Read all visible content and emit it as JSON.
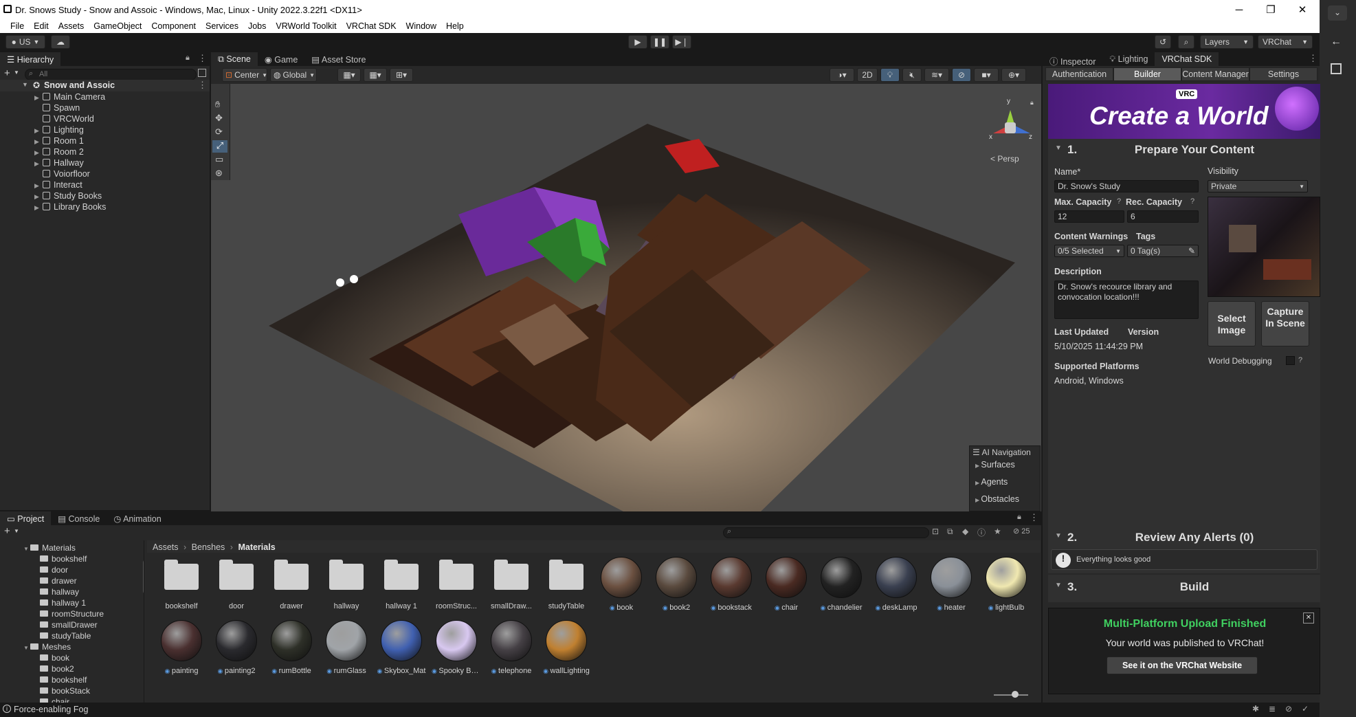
{
  "window": {
    "title": "Dr. Snows Study - Snow and Assoic - Windows, Mac, Linux - Unity 2022.3.22f1 <DX11>",
    "minimize": "─",
    "maximize": "❐",
    "close": "✕"
  },
  "menu": [
    "File",
    "Edit",
    "Assets",
    "GameObject",
    "Component",
    "Services",
    "Jobs",
    "VRWorld Toolkit",
    "VRChat SDK",
    "Window",
    "Help"
  ],
  "toolbar": {
    "account": "US",
    "layers": "Layers",
    "layout": "VRChat"
  },
  "hierarchy": {
    "tab": "Hierarchy",
    "search_placeholder": "All",
    "root": "Snow and Assoic",
    "items": [
      {
        "label": "Main Camera",
        "arrow": true
      },
      {
        "label": "Spawn",
        "arrow": false
      },
      {
        "label": "VRCWorld",
        "arrow": false
      },
      {
        "label": "Lighting",
        "arrow": true
      },
      {
        "label": "Room 1",
        "arrow": true
      },
      {
        "label": "Room 2",
        "arrow": true
      },
      {
        "label": "Hallway",
        "arrow": true
      },
      {
        "label": "Voiorfloor",
        "arrow": false
      },
      {
        "label": "Interact",
        "arrow": true
      },
      {
        "label": "Study Books",
        "arrow": true
      },
      {
        "label": "Library Books",
        "arrow": true
      }
    ]
  },
  "scene_tabs": [
    "Scene",
    "Game",
    "Asset Store"
  ],
  "scene_toolbar": {
    "pivot": "Center",
    "space": "Global",
    "mode2d": "2D"
  },
  "gizmo": {
    "persp": "< Persp",
    "y": "y",
    "x": "x",
    "z": "z"
  },
  "ai_nav": {
    "title": "AI Navigation",
    "items": [
      "Surfaces",
      "Agents",
      "Obstacles"
    ]
  },
  "inspector": {
    "tabs": [
      "Inspector",
      "Lighting",
      "VRChat SDK"
    ],
    "sdk_tabs": [
      "Authentication",
      "Builder",
      "Content Manager",
      "Settings"
    ],
    "banner": "Create a World",
    "banner_badge": "VRC",
    "sec1": {
      "num": "1.",
      "title": "Prepare Your Content"
    },
    "name_label": "Name*",
    "name_value": "Dr. Snow's Study",
    "visibility_label": "Visibility",
    "visibility_value": "Private",
    "maxcap_label": "Max. Capacity",
    "maxcap_value": "12",
    "reccap_label": "Rec. Capacity",
    "reccap_value": "6",
    "cw_label": "Content Warnings",
    "tags_label": "Tags",
    "cw_value": "0/5 Selected",
    "tags_value": "0 Tag(s)",
    "desc_label": "Description",
    "desc_value": "Dr. Snow's recource library and convocation location!!!",
    "updated_label": "Last Updated",
    "updated_value": "5/10/2025 11:44:29 PM",
    "version_label": "Version",
    "platforms_label": "Supported Platforms",
    "platforms_value": "Android, Windows",
    "select_image": "Select Image",
    "capture": "Capture In Scene",
    "debugging": "World Debugging",
    "sec2": {
      "num": "2.",
      "title": "Review Any Alerts (0)"
    },
    "alert": "Everything looks good",
    "sec3": {
      "num": "3.",
      "title": "Build"
    },
    "toast_title": "Multi-Platform Upload Finished",
    "toast_text": "Your world was published to VRChat!",
    "toast_button": "See it on the VRChat Website"
  },
  "project": {
    "tabs": [
      "Project",
      "Console",
      "Animation"
    ],
    "count": "25",
    "breadcrumb": [
      "Assets",
      "Benshes",
      "Materials"
    ],
    "tree": [
      {
        "label": "Materials",
        "level": 0,
        "open": true
      },
      {
        "label": "bookshelf",
        "level": 1
      },
      {
        "label": "door",
        "level": 1
      },
      {
        "label": "drawer",
        "level": 1
      },
      {
        "label": "hallway",
        "level": 1
      },
      {
        "label": "hallway 1",
        "level": 1
      },
      {
        "label": "roomStructure",
        "level": 1
      },
      {
        "label": "smallDrawer",
        "level": 1
      },
      {
        "label": "studyTable",
        "level": 1
      },
      {
        "label": "Meshes",
        "level": 0,
        "open": true
      },
      {
        "label": "book",
        "level": 1
      },
      {
        "label": "book2",
        "level": 1
      },
      {
        "label": "bookshelf",
        "level": 1
      },
      {
        "label": "bookStack",
        "level": 1
      },
      {
        "label": "chair",
        "level": 1
      }
    ],
    "folders": [
      "bookshelf",
      "door",
      "drawer",
      "hallway",
      "hallway 1",
      "roomStruc...",
      "smallDraw...",
      "studyTable"
    ],
    "materials_row1": [
      {
        "name": "book",
        "color": "#6b5040"
      },
      {
        "name": "book2",
        "color": "#5a4a3e"
      },
      {
        "name": "bookstack",
        "color": "#5a3a30"
      },
      {
        "name": "chair",
        "color": "#4a2a22"
      },
      {
        "name": "chandelier",
        "color": "#222222"
      },
      {
        "name": "deskLamp",
        "color": "#3a4050"
      },
      {
        "name": "heater",
        "color": "#8a9098"
      },
      {
        "name": "lightBulb",
        "color": "#f0e8b0"
      }
    ],
    "materials_row2": [
      {
        "name": "painting",
        "color": "#4a3030"
      },
      {
        "name": "painting2",
        "color": "#2a2a2e"
      },
      {
        "name": "rumBottle",
        "color": "#2e3028"
      },
      {
        "name": "rumGlass",
        "color": "#a0a4a8"
      },
      {
        "name": "Skybox_Mat",
        "color": "#4060b0"
      },
      {
        "name": "Spooky Bu...",
        "color": "#d8c8f0"
      },
      {
        "name": "telephone",
        "color": "#454045"
      },
      {
        "name": "wallLighting",
        "color": "#c08030"
      }
    ]
  },
  "status": "Force-enabling Fog"
}
